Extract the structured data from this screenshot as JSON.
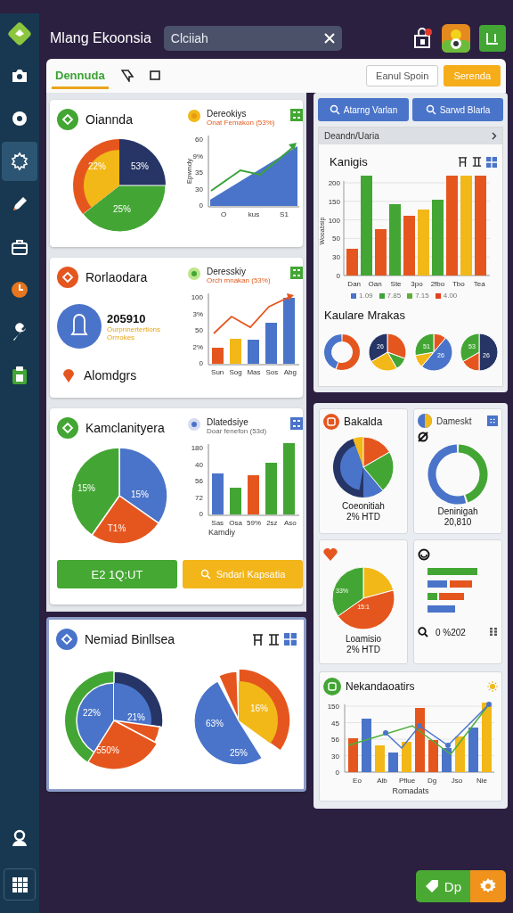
{
  "header": {
    "title": "Mlang Ekoonsia",
    "search": {
      "value": "Clciiah"
    }
  },
  "sidebar": {
    "items": [
      {
        "selected": false
      },
      {
        "selected": false
      },
      {
        "selected": true
      },
      {
        "selected": false
      },
      {
        "selected": false
      },
      {
        "selected": false
      },
      {
        "selected": false
      },
      {
        "selected": false
      }
    ]
  },
  "tabs": [
    {
      "label": "Dennuda",
      "selected": true
    },
    {
      "selected": false
    },
    {
      "selected": false
    }
  ],
  "toolbar_buttons": [
    {
      "label": "Eanul Spoin",
      "kind": "outline"
    },
    {
      "label": "Serenda",
      "kind": "primary"
    }
  ],
  "cards": [
    {
      "kind": "pie_area",
      "title": "Oiannda",
      "side_title": "Dereokiys",
      "side_subtitle": "Onat Femakon (53%)",
      "pie_labels": [
        "22%",
        "53%",
        "25%"
      ],
      "y_labels": [
        "60",
        "9%",
        "35",
        "30",
        "0"
      ],
      "y_title": "Epwndy",
      "x_labels": [
        "O",
        "kus",
        "S1"
      ]
    },
    {
      "kind": "metric_bars",
      "title": "Rorlaodara",
      "side_title": "Deresskiy",
      "side_subtitle": "Orch mnakan (53%)",
      "metric": {
        "value": "205910",
        "lines": [
          "Ourpnnertertions",
          "Orrrokes"
        ]
      },
      "note": "Alomdgrs",
      "y_labels": [
        "100",
        "3%",
        "50",
        "2%",
        "0"
      ],
      "x_labels": [
        "Sun",
        "Sog",
        "Mas",
        "Sos",
        "Abg"
      ]
    },
    {
      "kind": "pie_bars",
      "title": "Kamclanityera",
      "side_title": "Dlatedsiye",
      "side_subtitle": "Doar fenefon (53d)",
      "pie_labels": [
        "15%",
        "15%",
        "T1%"
      ],
      "y_labels": [
        "180",
        "40",
        "56",
        "72",
        "0"
      ],
      "x_labels": [
        "Sas",
        "Osa",
        "59%",
        "2sz",
        "Aso"
      ],
      "x_title": "Kamdiy",
      "buttons": [
        {
          "label": "E2 1Q:UT",
          "kind": "green"
        },
        {
          "label": "Sndari Kapsatia",
          "kind": "yellow"
        }
      ]
    },
    {
      "kind": "two_pies",
      "title": "Nemiad Binllsea",
      "pie_labels": [
        "22%",
        "21%",
        "550%"
      ],
      "pie2_labels": [
        "63%",
        "16%",
        "25%"
      ]
    }
  ],
  "right_panel": {
    "buttons": [
      "Atarng Varlan",
      "Sarwd Blarla"
    ],
    "breadcrumb": "Deandn/Uaria",
    "chart_title": "Kanigis",
    "y_labels": [
      "200",
      "150",
      "100",
      "50",
      "30",
      "0"
    ],
    "y_title": "Wooabsip",
    "x_labels": [
      "Dan",
      "Oan",
      "Ste",
      "3po",
      "2fbo",
      "Tbo",
      "Tea"
    ],
    "legend": [
      {
        "label": "1.09",
        "color": "#4a74c9"
      },
      {
        "label": "7.85",
        "color": "#3da23a"
      },
      {
        "label": "7.15",
        "color": "#5bb03a"
      },
      {
        "label": "4.00",
        "color": "#e0441f"
      }
    ],
    "mini_title": "Kaulare Mrakas",
    "mini_pies": [
      {
        "kind": "donut"
      },
      {
        "kind": "pie",
        "labels": [
          "26"
        ]
      },
      {
        "kind": "pie",
        "labels": [
          "51",
          "26"
        ]
      },
      {
        "kind": "pie",
        "labels": [
          "53",
          "26"
        ]
      }
    ]
  },
  "tiles": [
    {
      "kind": "pie",
      "title": "Bakalda",
      "caption": [
        "Coeonitiah",
        "2% HTD"
      ]
    },
    {
      "kind": "donut",
      "title": "Dameskt",
      "caption": [
        "Deninigah",
        "20,810"
      ]
    },
    {
      "kind": "pie_labeled",
      "labels": [
        "33%",
        "15:1"
      ],
      "caption": [
        "Loamisio",
        "2% HTD"
      ]
    },
    {
      "kind": "bars",
      "footer": "0 %202"
    }
  ],
  "trend": {
    "title": "Nekandaoatirs",
    "y_labels": [
      "150",
      "45",
      "56",
      "30",
      "0"
    ],
    "x_labels": [
      "Eo",
      "Alb",
      "Pflue",
      "Dg",
      "Jso",
      "Nie"
    ],
    "x_title": "Romadats"
  },
  "fab": {
    "label": "Dp"
  }
}
